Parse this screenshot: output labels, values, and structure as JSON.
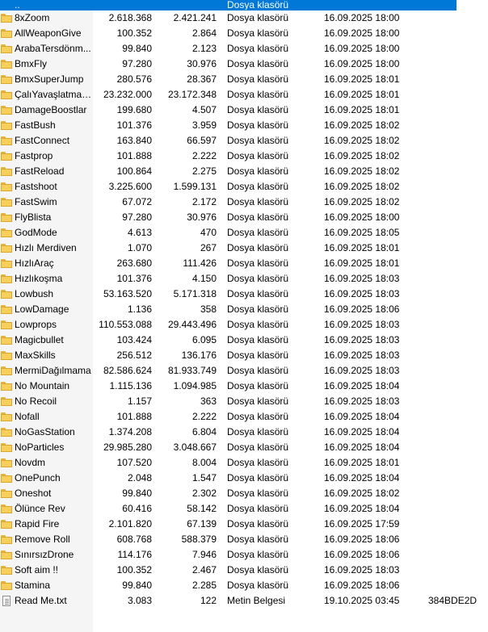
{
  "parent_row": {
    "name": "..",
    "type": "Dosya klasörü"
  },
  "rows": [
    {
      "name": "8xZoom",
      "size": "2.618.368",
      "packed": "2.421.241",
      "type": "Dosya klasörü",
      "modified": "16.09.2025 18:00",
      "crc": "",
      "icon": "folder-icon"
    },
    {
      "name": "AllWeaponGive",
      "size": "100.352",
      "packed": "2.864",
      "type": "Dosya klasörü",
      "modified": "16.09.2025 18:00",
      "crc": "",
      "icon": "folder-icon"
    },
    {
      "name": "ArabaTersdönm...",
      "size": "99.840",
      "packed": "2.123",
      "type": "Dosya klasörü",
      "modified": "16.09.2025 18:00",
      "crc": "",
      "icon": "folder-icon"
    },
    {
      "name": "BmxFly",
      "size": "97.280",
      "packed": "30.976",
      "type": "Dosya klasörü",
      "modified": "16.09.2025 18:00",
      "crc": "",
      "icon": "folder-icon"
    },
    {
      "name": "BmxSuperJump",
      "size": "280.576",
      "packed": "28.367",
      "type": "Dosya klasörü",
      "modified": "16.09.2025 18:01",
      "crc": "",
      "icon": "folder-icon"
    },
    {
      "name": "ÇalıYavaşlatmak...",
      "size": "23.232.000",
      "packed": "23.172.348",
      "type": "Dosya klasörü",
      "modified": "16.09.2025 18:01",
      "crc": "",
      "icon": "folder-icon"
    },
    {
      "name": "DamageBoostlar",
      "size": "199.680",
      "packed": "4.507",
      "type": "Dosya klasörü",
      "modified": "16.09.2025 18:01",
      "crc": "",
      "icon": "folder-icon"
    },
    {
      "name": "FastBush",
      "size": "101.376",
      "packed": "3.959",
      "type": "Dosya klasörü",
      "modified": "16.09.2025 18:02",
      "crc": "",
      "icon": "folder-icon"
    },
    {
      "name": "FastConnect",
      "size": "163.840",
      "packed": "66.597",
      "type": "Dosya klasörü",
      "modified": "16.09.2025 18:02",
      "crc": "",
      "icon": "folder-icon"
    },
    {
      "name": "Fastprop",
      "size": "101.888",
      "packed": "2.222",
      "type": "Dosya klasörü",
      "modified": "16.09.2025 18:02",
      "crc": "",
      "icon": "folder-icon"
    },
    {
      "name": "FastReload",
      "size": "100.864",
      "packed": "2.275",
      "type": "Dosya klasörü",
      "modified": "16.09.2025 18:02",
      "crc": "",
      "icon": "folder-icon"
    },
    {
      "name": "Fastshoot",
      "size": "3.225.600",
      "packed": "1.599.131",
      "type": "Dosya klasörü",
      "modified": "16.09.2025 18:02",
      "crc": "",
      "icon": "folder-icon"
    },
    {
      "name": "FastSwim",
      "size": "67.072",
      "packed": "2.172",
      "type": "Dosya klasörü",
      "modified": "16.09.2025 18:02",
      "crc": "",
      "icon": "folder-icon"
    },
    {
      "name": "FlyBlista",
      "size": "97.280",
      "packed": "30.976",
      "type": "Dosya klasörü",
      "modified": "16.09.2025 18:00",
      "crc": "",
      "icon": "folder-icon"
    },
    {
      "name": "GodMode",
      "size": "4.613",
      "packed": "470",
      "type": "Dosya klasörü",
      "modified": "16.09.2025 18:05",
      "crc": "",
      "icon": "folder-icon"
    },
    {
      "name": "Hızlı Merdiven",
      "size": "1.070",
      "packed": "267",
      "type": "Dosya klasörü",
      "modified": "16.09.2025 18:01",
      "crc": "",
      "icon": "folder-icon"
    },
    {
      "name": "HızlıAraç",
      "size": "263.680",
      "packed": "111.426",
      "type": "Dosya klasörü",
      "modified": "16.09.2025 18:01",
      "crc": "",
      "icon": "folder-icon"
    },
    {
      "name": "Hızlıkoşma",
      "size": "101.376",
      "packed": "4.150",
      "type": "Dosya klasörü",
      "modified": "16.09.2025 18:03",
      "crc": "",
      "icon": "folder-icon"
    },
    {
      "name": "Lowbush",
      "size": "53.163.520",
      "packed": "5.171.318",
      "type": "Dosya klasörü",
      "modified": "16.09.2025 18:03",
      "crc": "",
      "icon": "folder-icon"
    },
    {
      "name": "LowDamage",
      "size": "1.136",
      "packed": "358",
      "type": "Dosya klasörü",
      "modified": "16.09.2025 18:06",
      "crc": "",
      "icon": "folder-icon"
    },
    {
      "name": "Lowprops",
      "size": "110.553.088",
      "packed": "29.443.496",
      "type": "Dosya klasörü",
      "modified": "16.09.2025 18:03",
      "crc": "",
      "icon": "folder-icon"
    },
    {
      "name": "Magicbullet",
      "size": "103.424",
      "packed": "6.095",
      "type": "Dosya klasörü",
      "modified": "16.09.2025 18:03",
      "crc": "",
      "icon": "folder-icon"
    },
    {
      "name": "MaxSkills",
      "size": "256.512",
      "packed": "136.176",
      "type": "Dosya klasörü",
      "modified": "16.09.2025 18:03",
      "crc": "",
      "icon": "folder-icon"
    },
    {
      "name": "MermiDağılmama",
      "size": "82.586.624",
      "packed": "81.933.749",
      "type": "Dosya klasörü",
      "modified": "16.09.2025 18:03",
      "crc": "",
      "icon": "folder-icon"
    },
    {
      "name": "No Mountain",
      "size": "1.115.136",
      "packed": "1.094.985",
      "type": "Dosya klasörü",
      "modified": "16.09.2025 18:04",
      "crc": "",
      "icon": "folder-icon"
    },
    {
      "name": "No Recoil",
      "size": "1.157",
      "packed": "363",
      "type": "Dosya klasörü",
      "modified": "16.09.2025 18:03",
      "crc": "",
      "icon": "folder-icon"
    },
    {
      "name": "Nofall",
      "size": "101.888",
      "packed": "2.222",
      "type": "Dosya klasörü",
      "modified": "16.09.2025 18:04",
      "crc": "",
      "icon": "folder-icon"
    },
    {
      "name": "NoGasStation",
      "size": "1.374.208",
      "packed": "6.804",
      "type": "Dosya klasörü",
      "modified": "16.09.2025 18:04",
      "crc": "",
      "icon": "folder-icon"
    },
    {
      "name": "NoParticles",
      "size": "29.985.280",
      "packed": "3.048.667",
      "type": "Dosya klasörü",
      "modified": "16.09.2025 18:04",
      "crc": "",
      "icon": "folder-icon"
    },
    {
      "name": "Novdm",
      "size": "107.520",
      "packed": "8.004",
      "type": "Dosya klasörü",
      "modified": "16.09.2025 18:01",
      "crc": "",
      "icon": "folder-icon"
    },
    {
      "name": "OnePunch",
      "size": "2.048",
      "packed": "1.547",
      "type": "Dosya klasörü",
      "modified": "16.09.2025 18:04",
      "crc": "",
      "icon": "folder-icon"
    },
    {
      "name": "Oneshot",
      "size": "99.840",
      "packed": "2.302",
      "type": "Dosya klasörü",
      "modified": "16.09.2025 18:02",
      "crc": "",
      "icon": "folder-icon"
    },
    {
      "name": "Ölünce Rev",
      "size": "60.416",
      "packed": "58.142",
      "type": "Dosya klasörü",
      "modified": "16.09.2025 18:04",
      "crc": "",
      "icon": "folder-icon"
    },
    {
      "name": "Rapid Fire",
      "size": "2.101.820",
      "packed": "67.139",
      "type": "Dosya klasörü",
      "modified": "16.09.2025 17:59",
      "crc": "",
      "icon": "folder-icon"
    },
    {
      "name": "Remove Roll",
      "size": "608.768",
      "packed": "588.379",
      "type": "Dosya klasörü",
      "modified": "16.09.2025 18:06",
      "crc": "",
      "icon": "folder-icon"
    },
    {
      "name": "SınırsızDrone",
      "size": "114.176",
      "packed": "7.946",
      "type": "Dosya klasörü",
      "modified": "16.09.2025 18:06",
      "crc": "",
      "icon": "folder-icon"
    },
    {
      "name": "Soft aim !!",
      "size": "100.352",
      "packed": "2.467",
      "type": "Dosya klasörü",
      "modified": "16.09.2025 18:03",
      "crc": "",
      "icon": "folder-icon"
    },
    {
      "name": "Stamina",
      "size": "99.840",
      "packed": "2.285",
      "type": "Dosya klasörü",
      "modified": "16.09.2025 18:06",
      "crc": "",
      "icon": "folder-icon"
    },
    {
      "name": "Read Me.txt",
      "size": "3.083",
      "packed": "122",
      "type": "Metin Belgesi",
      "modified": "19.10.2025 03:45",
      "crc": "384BDE2D",
      "icon": "text-file-icon"
    }
  ],
  "colors": {
    "selection": "#0078d7",
    "folder": "#f8cf5b"
  }
}
